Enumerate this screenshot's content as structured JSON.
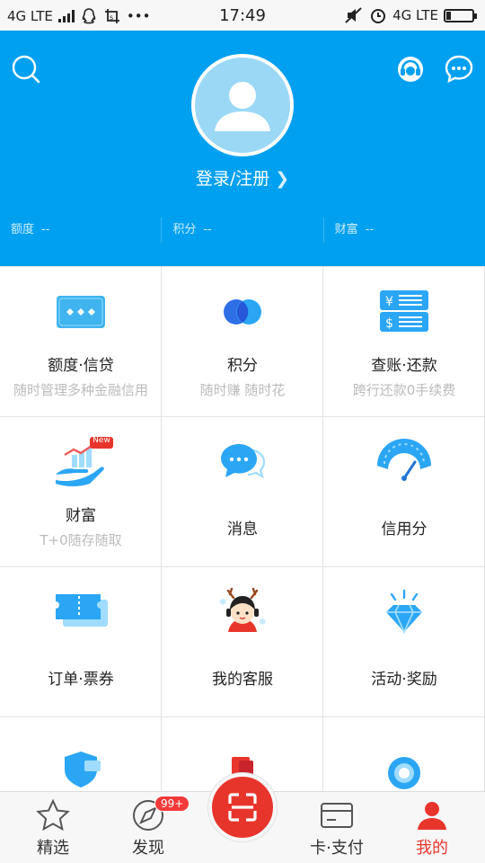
{
  "status_bar": {
    "left_network": "4G LTE",
    "time": "17:49",
    "right_network": "4G LTE"
  },
  "header": {
    "login_label": "登录/注册",
    "stats": [
      {
        "label": "额度",
        "value": "--"
      },
      {
        "label": "积分",
        "value": "--"
      },
      {
        "label": "财富",
        "value": "--"
      }
    ]
  },
  "grid": {
    "items": [
      {
        "title": "额度·信贷",
        "subtitle": "随时管理多种金融信用",
        "icon": "credit-card-icon"
      },
      {
        "title": "积分",
        "subtitle": "随时赚 随时花",
        "icon": "points-circles-icon"
      },
      {
        "title": "查账·还款",
        "subtitle": "跨行还款0手续费",
        "icon": "bill-icon"
      },
      {
        "title": "财富",
        "subtitle": "T+0随存随取",
        "badge": "New",
        "icon": "wealth-hand-icon"
      },
      {
        "title": "消息",
        "subtitle": "",
        "icon": "message-bubble-icon"
      },
      {
        "title": "信用分",
        "subtitle": "",
        "icon": "credit-gauge-icon"
      },
      {
        "title": "订单·票券",
        "subtitle": "",
        "icon": "ticket-icon"
      },
      {
        "title": "我的客服",
        "subtitle": "",
        "icon": "customer-service-icon"
      },
      {
        "title": "活动·奖励",
        "subtitle": "",
        "icon": "diamond-icon"
      }
    ]
  },
  "tabbar": {
    "tabs": [
      {
        "label": "精选",
        "icon": "star-icon"
      },
      {
        "label": "发现",
        "icon": "compass-icon",
        "badge": "99+"
      },
      {
        "label": "卡·支付",
        "icon": "card-icon"
      },
      {
        "label": "我的",
        "icon": "person-icon"
      }
    ],
    "active": "我的"
  },
  "colors": {
    "header_blue": "#00a0f0",
    "accent_red": "#e8352c"
  }
}
